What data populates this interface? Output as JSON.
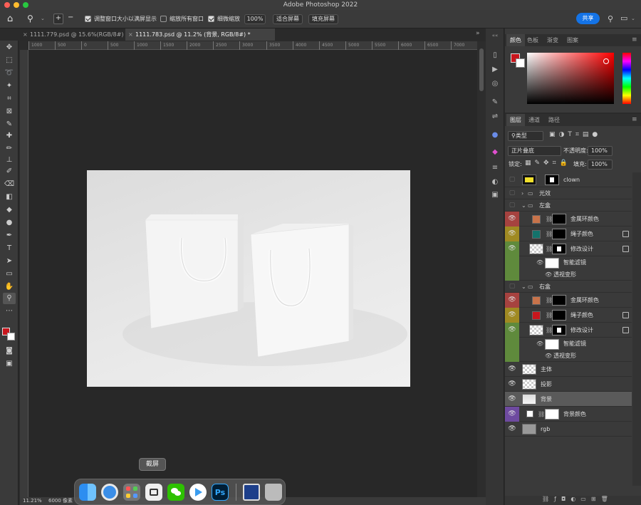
{
  "app": {
    "title": "Adobe Photoshop 2022"
  },
  "options": {
    "resize_windows_label": "调整窗口大小以满屏显示",
    "zoom_all_label": "缩放所有窗口",
    "scrubby_zoom_label": "细微缩放",
    "zoom_value": "100%",
    "fit_screen_label": "适合屏幕",
    "fill_screen_label": "填充屏幕",
    "share_label": "共享"
  },
  "tabs": [
    {
      "label": "1111.779.psd @ 15.6%(RGB/8#)"
    },
    {
      "label": "1111.783.psd @ 11.2% (背景, RGB/8#) *"
    }
  ],
  "ruler": {
    "h_ticks": [
      "1000",
      "500",
      "0",
      "500",
      "1000",
      "1500",
      "2000",
      "2500",
      "3000",
      "3500",
      "4000",
      "4500",
      "5000",
      "5500",
      "6000",
      "6500",
      "7000"
    ]
  },
  "status": {
    "zoom": "11.21%",
    "doc_size": "6000 像素"
  },
  "dock": {
    "tooltip": "截屏",
    "icons": [
      "finder-icon",
      "safari-icon",
      "launchpad-icon",
      "screenshot-icon",
      "wechat-icon",
      "video-icon",
      "photoshop-icon",
      "preview-icon",
      "trash-icon"
    ],
    "photoshop_label": "Ps"
  },
  "color_panel": {
    "tabs": [
      "颜色",
      "色板",
      "渐变",
      "图案"
    ],
    "foreground": "#c8161d",
    "background": "#ffffff"
  },
  "layers_panel": {
    "tabs": [
      "图层",
      "通道",
      "路径"
    ],
    "filter_label": "类型",
    "blend_mode": "正片叠底",
    "opacity_label": "不透明度:",
    "opacity_value": "100%",
    "lock_label": "锁定:",
    "fill_label": "填充:",
    "fill_value": "100%",
    "layers": [
      {
        "name": "clown"
      },
      {
        "name": "光效"
      },
      {
        "name": "左盒"
      },
      {
        "name": "金属环颜色"
      },
      {
        "name": "绳子颜色"
      },
      {
        "name": "修改设计"
      },
      {
        "name": "智能滤镜"
      },
      {
        "name": "透视变形"
      },
      {
        "name": "右盒"
      },
      {
        "name": "金属环颜色"
      },
      {
        "name": "绳子颜色"
      },
      {
        "name": "修改设计"
      },
      {
        "name": "智能滤镜"
      },
      {
        "name": "透视变形"
      },
      {
        "name": "主体"
      },
      {
        "name": "投影"
      },
      {
        "name": "背景"
      },
      {
        "name": "背景颜色"
      },
      {
        "name": "rgb"
      }
    ],
    "colors": {
      "orange": "#c8734a",
      "teal": "#13736b",
      "red": "#c8161d",
      "tag_red": "#a6423f",
      "tag_yellow": "#a08a22",
      "tag_green": "#5f8a3c",
      "tag_violet": "#6e4aa0"
    }
  }
}
